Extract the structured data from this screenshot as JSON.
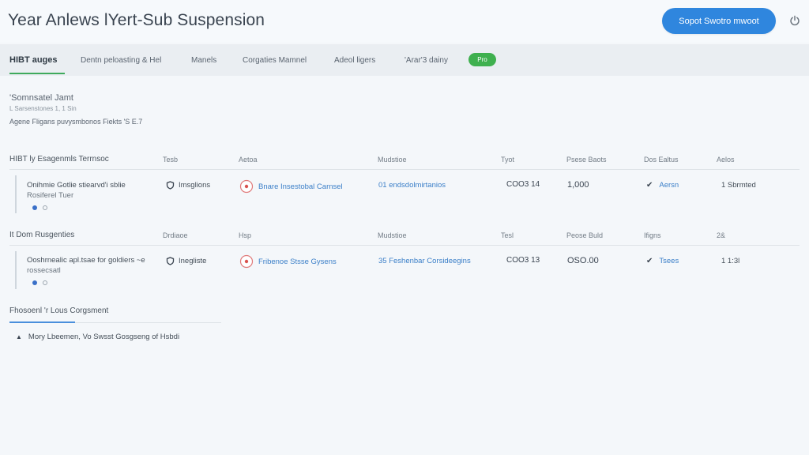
{
  "header": {
    "title": "Year Anlews lYert-Sub Suspension",
    "primary_button": "Sopot Swotro mwoot",
    "power_icon": "power-icon"
  },
  "tabs": [
    {
      "label": "HIBT auges",
      "active": true
    },
    {
      "label": "Dentn peloasting & Hel",
      "active": false
    },
    {
      "label": "Manels",
      "active": false
    },
    {
      "label": "Corgaties Mamnel",
      "active": false
    },
    {
      "label": "Adeol ligers",
      "active": false
    },
    {
      "label": "'Arar'3 dainy",
      "active": false
    }
  ],
  "badge": "Pro",
  "info": {
    "line1": "'Somnsatel Jamt",
    "line2": "L Sarsenstones 1, 1 Sin",
    "line3": "Agene Fligans puvysmbonos Fiekts 'S E.7"
  },
  "tables": [
    {
      "headers": [
        "HIBT ly Esagenmls Terrnsoc",
        "Tesb",
        "Aetoa",
        "Mudstioe",
        "Tyot",
        "Psese Baots",
        "Dos Ealtus",
        "Aelos"
      ],
      "rows": [
        {
          "name_line1": "Onihmie Gotlie stiearvd'i sblie",
          "name_line2": "Rosiferel Tuer",
          "type": "Imsglions",
          "action": "Bnare Insestobal Carnsel",
          "module": "01 endsdolmirtanios",
          "code": "COO3 14",
          "amount": "1,000",
          "status": "Aersn",
          "result": "1 Sbrmted"
        }
      ]
    },
    {
      "headers": [
        "It Dom Rusgenties",
        "Drdiaoe",
        "Hsp",
        "Mudstioe",
        "Tesl",
        "Peose Buld",
        "Ifigns",
        "2&"
      ],
      "rows": [
        {
          "name_line1": "Ooshrnealic apl.tsae for goldiers ~e",
          "name_line2": "rossecsatl",
          "type": "Inegliste",
          "action": "Fribenoe Stsse Gysens",
          "module": "35 Feshenbar Corsideegins",
          "code": "COO3 13",
          "amount": "OSO.00",
          "status": "Tsees",
          "result": "1 1:3l"
        }
      ]
    }
  ],
  "section": {
    "title": "Fhosoenl 'r Lous Corgsment",
    "item": "Mory Lbeemen, Vo Swsst Gosgseng of Hsbdi"
  },
  "colors": {
    "accent_blue": "#2f86de",
    "active_tab_underline": "#3eaa5c",
    "badge_green": "#3fb04f",
    "link_blue": "#3b7fc8"
  }
}
